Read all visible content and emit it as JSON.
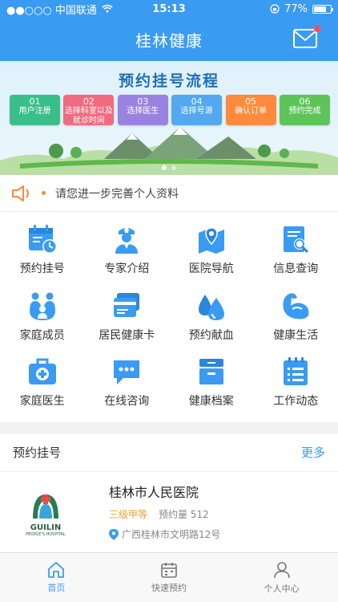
{
  "status_bar": {
    "carrier": "●●○○○ 中国联通",
    "time": "15:13",
    "battery": "77%",
    "battery_level": 0.77
  },
  "nav": {
    "title": "桂林健康"
  },
  "banner": {
    "title": "预约挂号流程",
    "steps": [
      {
        "num": "01",
        "label": "用户注册",
        "color": "#3bbf8a"
      },
      {
        "num": "02",
        "label": "选择科室以及就诊时间",
        "color": "#f16b80"
      },
      {
        "num": "03",
        "label": "选择医生",
        "color": "#9a83e0"
      },
      {
        "num": "04",
        "label": "选择号源",
        "color": "#53a8f0"
      },
      {
        "num": "05",
        "label": "确认订单",
        "color": "#ff8a3d"
      },
      {
        "num": "06",
        "label": "预约完成",
        "color": "#5ec45a"
      }
    ]
  },
  "notice": {
    "text": "请您进一步完善个人资料"
  },
  "services": [
    {
      "label": "预约挂号",
      "icon": "calendar-clock-icon"
    },
    {
      "label": "专家介绍",
      "icon": "doctor-icon"
    },
    {
      "label": "医院导航",
      "icon": "map-pin-icon"
    },
    {
      "label": "信息查询",
      "icon": "search-document-icon"
    },
    {
      "label": "家庭成员",
      "icon": "family-icon"
    },
    {
      "label": "居民健康卡",
      "icon": "health-card-icon"
    },
    {
      "label": "预约献血",
      "icon": "blood-drop-icon"
    },
    {
      "label": "健康生活",
      "icon": "muscle-icon"
    },
    {
      "label": "家庭医生",
      "icon": "medical-kit-icon"
    },
    {
      "label": "在线咨询",
      "icon": "chat-icon"
    },
    {
      "label": "健康档案",
      "icon": "archive-box-icon"
    },
    {
      "label": "工作动态",
      "icon": "checklist-icon"
    }
  ],
  "appointment_section": {
    "title": "预约挂号",
    "more": "更多",
    "hospital": {
      "name": "桂林市人民医院",
      "grade": "三级甲等",
      "volume": "预约量 512",
      "address": "广西桂林市文明路12号",
      "logo_text": "GUILIN",
      "logo_sub": "PEOPLE'S HOSPITAL"
    }
  },
  "tabbar": [
    {
      "label": "首页",
      "icon": "home-icon",
      "active": true
    },
    {
      "label": "快速预约",
      "icon": "calendar-icon",
      "active": false
    },
    {
      "label": "个人中心",
      "icon": "user-icon",
      "active": false
    }
  ],
  "colors": {
    "primary": "#3a9bf2",
    "accent": "#f58a42"
  }
}
